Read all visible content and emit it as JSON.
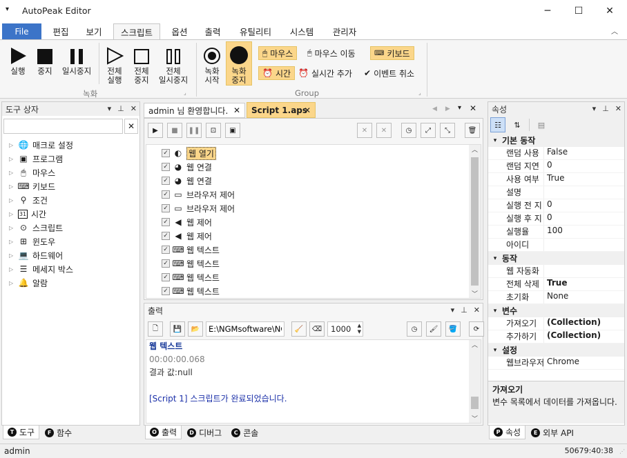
{
  "app": {
    "title": "AutoPeak Editor",
    "window_buttons": [
      "─",
      "☐",
      "✕"
    ]
  },
  "menu": {
    "file": "File",
    "tabs": [
      "편집",
      "보기",
      "스크립트",
      "옵션",
      "출력",
      "유틸리티",
      "시스템",
      "관리자"
    ],
    "active_tab": "스크립트"
  },
  "ribbon": {
    "record_group": {
      "label": "녹화",
      "buttons": [
        {
          "label": "실행",
          "icon": "play-icon"
        },
        {
          "label": "중지",
          "icon": "stop-icon"
        },
        {
          "label": "일시중지",
          "icon": "pause-icon"
        },
        {
          "label": "전체\n실행",
          "icon": "play-outline-icon"
        },
        {
          "label": "전체\n중지",
          "icon": "stop-outline-icon"
        },
        {
          "label": "전체\n일시중지",
          "icon": "pause-outline-icon"
        }
      ]
    },
    "group": {
      "label": "Group",
      "buttons": [
        {
          "label": "녹화\n시작",
          "icon": "record-start-icon"
        },
        {
          "label": "녹화\n중지",
          "icon": "record-stop-icon"
        }
      ],
      "options": [
        {
          "label": "마우스",
          "icon": "mouse-icon",
          "active": true
        },
        {
          "label": "마우스 이동",
          "icon": "mouse-move-icon",
          "active": false
        },
        {
          "label": "키보드",
          "icon": "keyboard-icon",
          "active": true
        },
        {
          "label": "시간",
          "icon": "alarm-icon",
          "active": true
        },
        {
          "label": "실시간 추가",
          "icon": "alarm-add-icon",
          "active": false
        },
        {
          "label": "이벤트 취소",
          "icon": "check-circle-icon",
          "active": false
        }
      ]
    }
  },
  "toolbox": {
    "title": "도구 상자",
    "search_value": "",
    "items": [
      {
        "label": "매크로 설정",
        "icon": "globe-icon"
      },
      {
        "label": "프로그램",
        "icon": "program-icon"
      },
      {
        "label": "마우스",
        "icon": "mouse-icon"
      },
      {
        "label": "키보드",
        "icon": "keyboard-icon"
      },
      {
        "label": "조건",
        "icon": "condition-icon"
      },
      {
        "label": "시간",
        "icon": "calendar-icon"
      },
      {
        "label": "스크립트",
        "icon": "script-icon"
      },
      {
        "label": "윈도우",
        "icon": "windows-icon"
      },
      {
        "label": "하드웨어",
        "icon": "laptop-icon"
      },
      {
        "label": "메세지 박스",
        "icon": "message-icon"
      },
      {
        "label": "알람",
        "icon": "bell-icon"
      }
    ],
    "bottom_tabs": [
      {
        "label": "도구",
        "badge": "T"
      },
      {
        "label": "함수",
        "badge": "F"
      }
    ]
  },
  "editor": {
    "tabs": [
      {
        "label": "admin 님 환영합니다.",
        "active": false
      },
      {
        "label": "Script 1.aps",
        "active": true
      }
    ],
    "rows": [
      {
        "label": "웹 열기",
        "icon": "web-icon",
        "selected": true
      },
      {
        "label": "웹 연결",
        "icon": "web-link-icon",
        "selected": false
      },
      {
        "label": "웹 연결",
        "icon": "web-link-icon",
        "selected": false
      },
      {
        "label": "브라우저 제어",
        "icon": "browser-icon",
        "selected": false
      },
      {
        "label": "브라우저 제어",
        "icon": "browser-icon",
        "selected": false
      },
      {
        "label": "웹 제어",
        "icon": "web-control-icon",
        "selected": false
      },
      {
        "label": "웹 제어",
        "icon": "web-control-icon",
        "selected": false
      },
      {
        "label": "웹 텍스트",
        "icon": "keyboard-icon",
        "selected": false
      },
      {
        "label": "웹 텍스트",
        "icon": "keyboard-icon",
        "selected": false
      },
      {
        "label": "웹 텍스트",
        "icon": "keyboard-icon",
        "selected": false
      },
      {
        "label": "웹 텍스트",
        "icon": "keyboard-icon",
        "selected": false
      }
    ]
  },
  "output": {
    "title": "출력",
    "path": "E:\\NGMsoftware\\NG",
    "count": "1000",
    "lines": [
      {
        "text": "웹 텍스트",
        "color": "#1b3c9a",
        "bold": true
      },
      {
        "text": "00:00:00.068",
        "color": "#808080",
        "bold": false
      },
      {
        "text": "결과 값:null",
        "color": "#333333",
        "bold": false
      },
      {
        "text": "",
        "color": "#333333",
        "bold": false
      },
      {
        "text": "[Script 1] 스크립트가 완료되었습니다.",
        "color": "#1a2fa8",
        "bold": false
      }
    ],
    "bottom_tabs": [
      {
        "label": "출력",
        "badge": "O"
      },
      {
        "label": "디버그",
        "badge": "D"
      },
      {
        "label": "콘솔",
        "badge": "C"
      }
    ]
  },
  "properties": {
    "title": "속성",
    "categories": [
      {
        "name": "기본 동작",
        "rows": [
          {
            "name": "랜덤 사용",
            "value": "False",
            "bold": false
          },
          {
            "name": "랜덤 지연",
            "value": "0",
            "bold": false
          },
          {
            "name": "사용 여부",
            "value": "True",
            "bold": false
          },
          {
            "name": "설명",
            "value": "",
            "bold": false
          },
          {
            "name": "실행 전 지",
            "value": "0",
            "bold": false
          },
          {
            "name": "실행 후 지",
            "value": "0",
            "bold": false
          },
          {
            "name": "실행율",
            "value": "100",
            "bold": false
          },
          {
            "name": "아이디",
            "value": "",
            "bold": false
          }
        ]
      },
      {
        "name": "동작",
        "rows": [
          {
            "name": "웹 자동화",
            "value": "",
            "bold": false
          },
          {
            "name": "전체 삭제",
            "value": "True",
            "bold": true
          },
          {
            "name": "초기화",
            "value": "None",
            "bold": false
          }
        ]
      },
      {
        "name": "변수",
        "rows": [
          {
            "name": "가져오기",
            "value": "(Collection)",
            "bold": true
          },
          {
            "name": "추가하기",
            "value": "(Collection)",
            "bold": true
          }
        ]
      },
      {
        "name": "설정",
        "rows": [
          {
            "name": "웹브라우저",
            "value": "Chrome",
            "bold": false
          }
        ]
      }
    ],
    "help_title": "가져오기",
    "help_text": "변수 목록에서 데이터를 가져옵니다.",
    "bottom_tabs": [
      {
        "label": "속성",
        "badge": "P"
      },
      {
        "label": "외부 API",
        "badge": "E"
      }
    ]
  },
  "status": {
    "user": "admin",
    "time": "50679:40:38"
  }
}
